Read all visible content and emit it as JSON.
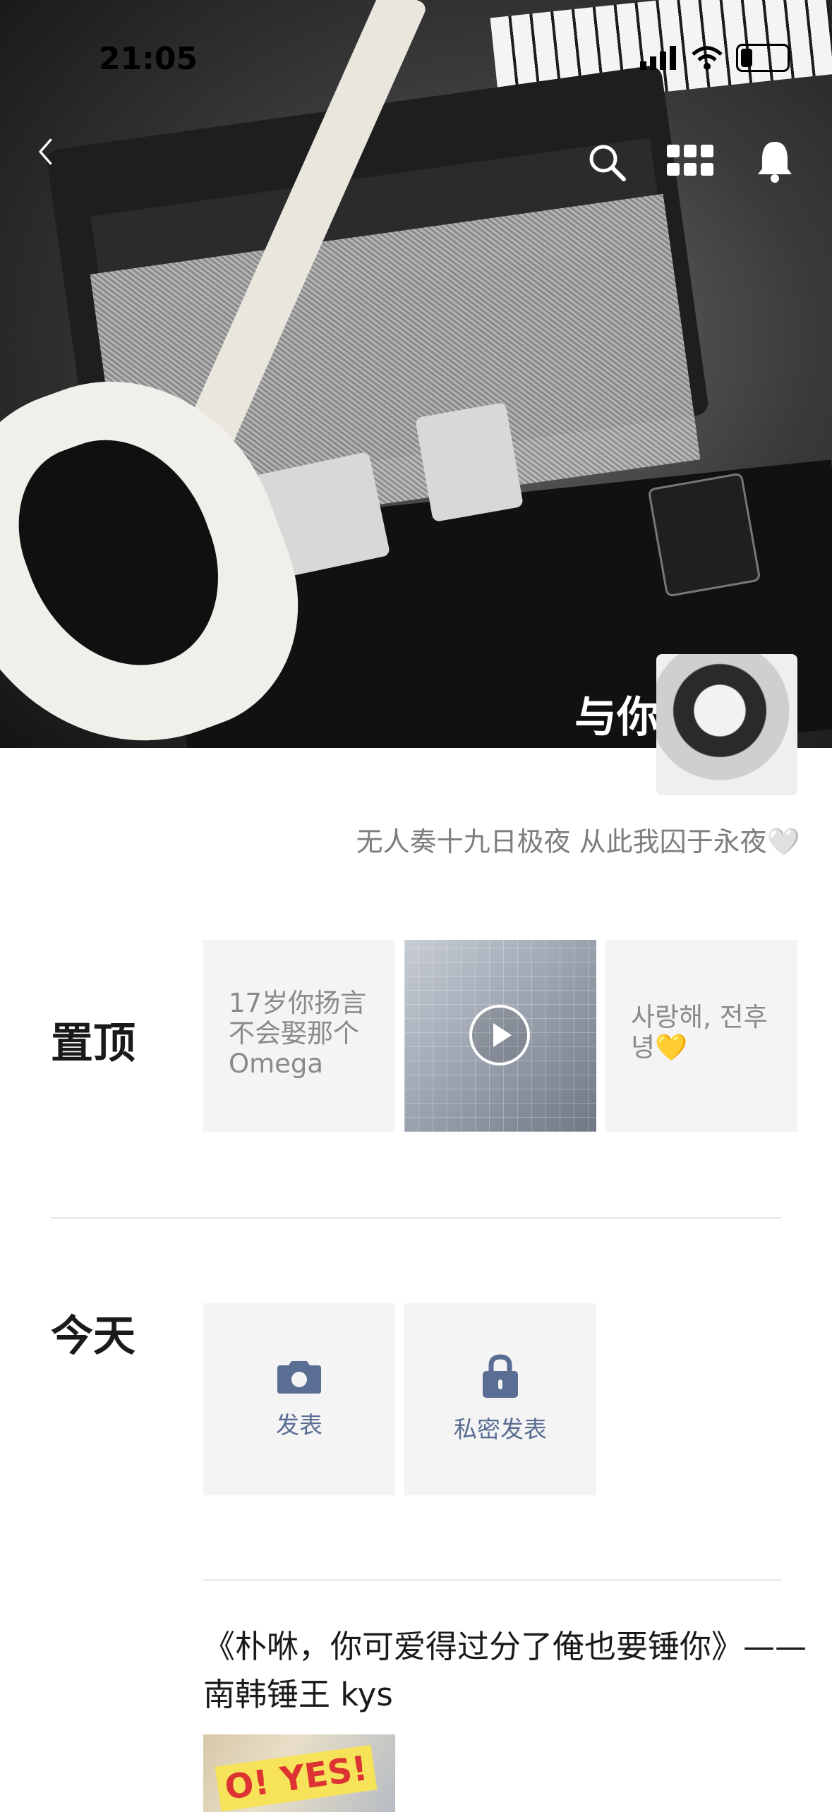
{
  "status_bar": {
    "time": "21:05"
  },
  "header": {
    "icons": [
      "back-chevron-icon",
      "search-icon",
      "grid-icon",
      "bell-icon"
    ]
  },
  "profile": {
    "nickname": "与你",
    "signature": "无人奏十九日极夜 从此我囚于永夜🤍"
  },
  "sections": {
    "pinned": {
      "title": "置顶",
      "items": [
        {
          "type": "text",
          "text": "17岁你扬言不会娶那个Omega"
        },
        {
          "type": "video",
          "icon": "play-icon"
        },
        {
          "type": "text",
          "text": "사랑해, 전후녕💛"
        }
      ]
    },
    "today": {
      "title": "今天",
      "actions": [
        {
          "label": "发表",
          "icon": "camera-icon"
        },
        {
          "label": "私密发表",
          "icon": "lock-icon"
        }
      ]
    }
  },
  "post": {
    "text": "《朴咻，你可爱得过分了俺也要锤你》—— 南韩锤王 kys",
    "thumb_sign": "O! YES!"
  },
  "colors": {
    "accent": "#5a6e93",
    "card_bg": "#f4f4f4",
    "signature": "#7d7d7d"
  }
}
